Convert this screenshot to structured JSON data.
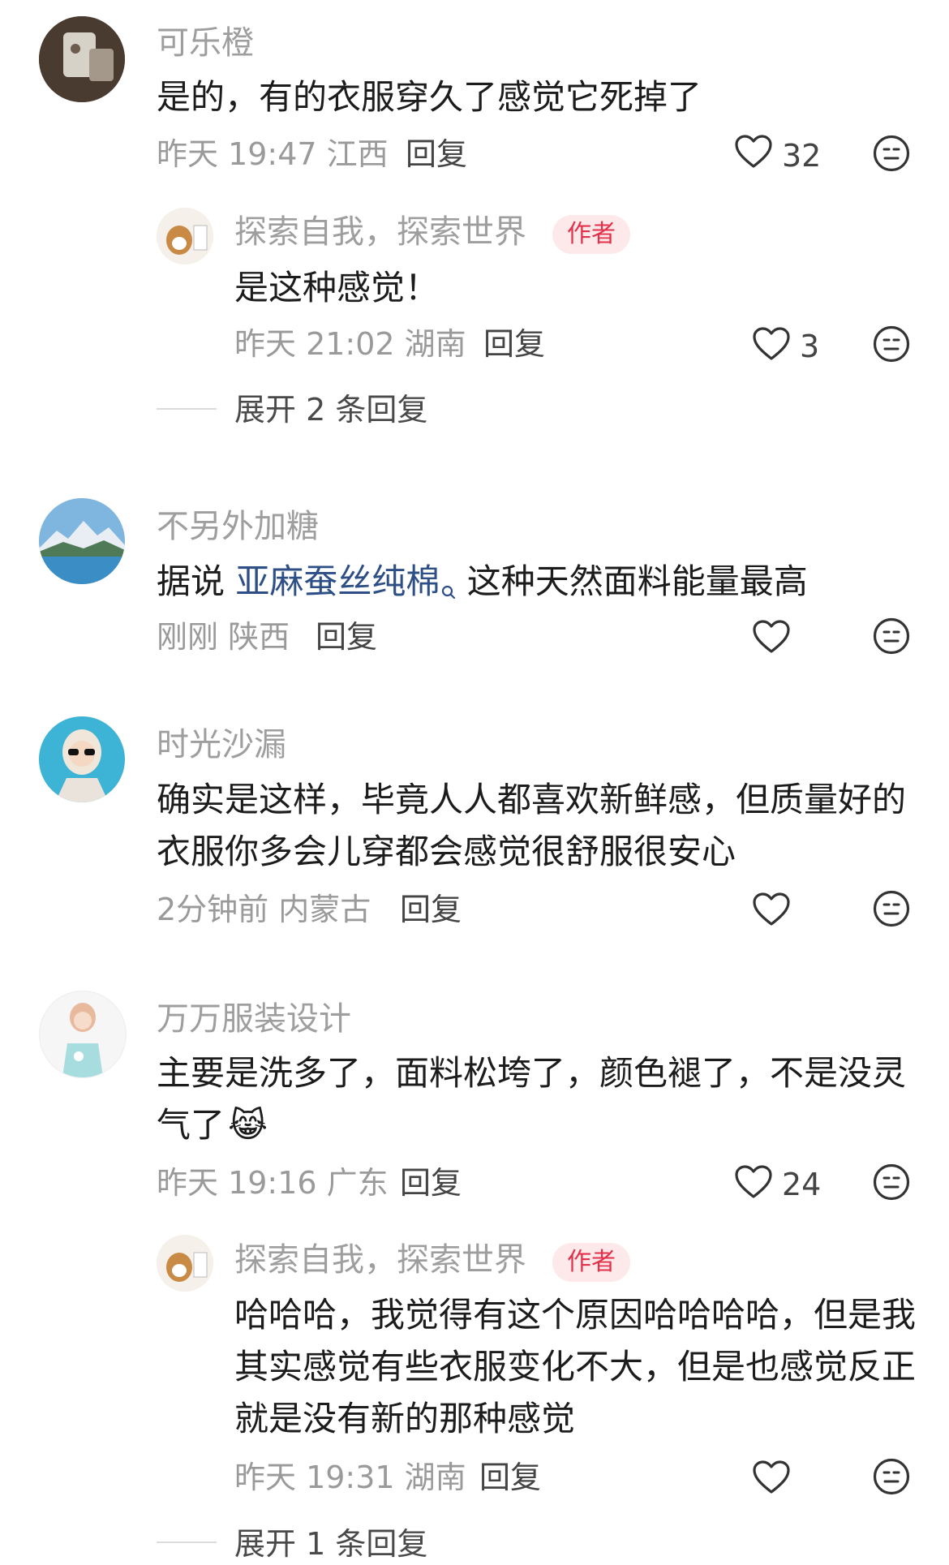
{
  "comments": [
    {
      "user": "可乐橙",
      "text": "是的，有的衣服穿久了感觉它死掉了",
      "time": "昨天 19:47 江西",
      "reply": "回复",
      "likes": "32",
      "replies": [
        {
          "user": "探索自我，探索世界",
          "badge": "作者",
          "text": "是这种感觉！",
          "time": "昨天 21:02 湖南",
          "reply": "回复",
          "likes": "3"
        }
      ],
      "expand": "展开 2 条回复"
    },
    {
      "user": "不另外加糖",
      "text_prefix": "据说 ",
      "text_link": "亚麻蚕丝纯棉",
      "text_suffix": " 这种天然面料能量最高",
      "time": "刚刚 陕西",
      "reply": "回复"
    },
    {
      "user": "时光沙漏",
      "text_line1": "确实是这样，毕竟人人都喜欢新鲜感，但质量好的",
      "text_line2": "衣服你多会儿穿都会感觉很舒服很安心",
      "time": "2分钟前 内蒙古",
      "reply": "回复"
    },
    {
      "user": "万万服装设计",
      "text_line1": "主要是洗多了，面料松垮了，颜色褪了，不是没灵",
      "text_line2": "气了",
      "emoji": "😹",
      "time": "昨天 19:16 广东",
      "reply": "回复",
      "likes": "24",
      "replies": [
        {
          "user": "探索自我，探索世界",
          "badge": "作者",
          "text_line1": "哈哈哈，我觉得有这个原因哈哈哈哈，但是我",
          "text_line2": "其实感觉有些衣服变化不大，但是也感觉反正",
          "text_line3": "就是没有新的那种感觉",
          "time": "昨天 19:31 湖南",
          "reply": "回复"
        }
      ],
      "expand": "展开 1 条回复"
    }
  ],
  "icons": {
    "like": "heart-outline-icon",
    "dislike": "neutral-face-icon",
    "search": "search-icon"
  },
  "colors": {
    "author_badge_bg": "#fde8ea",
    "author_badge_text": "#e2324b",
    "link": "#2d4f86"
  }
}
